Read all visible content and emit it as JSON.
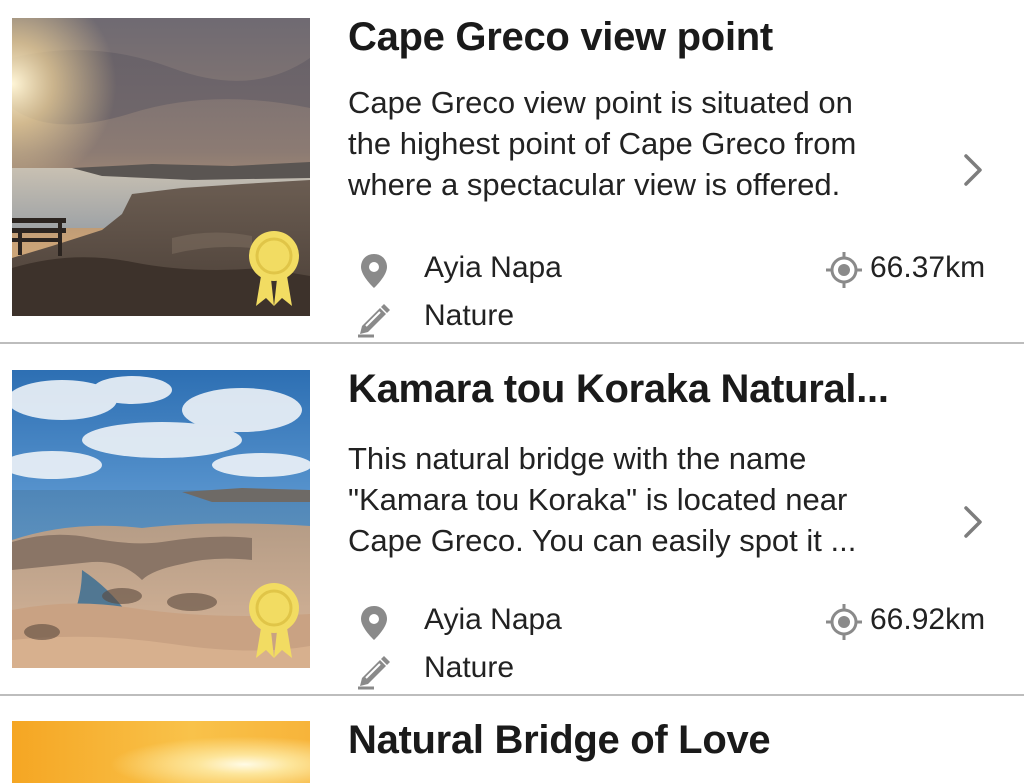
{
  "places": [
    {
      "title": "Cape Greco view point",
      "description_lines": [
        "Cape Greco view point is situated on",
        "the highest point of Cape Greco from",
        "where a spectacular view is offered."
      ],
      "location": "Ayia Napa",
      "category": "Nature",
      "distance": "66.37km",
      "badge_icon": "award-ribbon-icon"
    },
    {
      "title": "Kamara tou Koraka Natural...",
      "description_lines": [
        "This natural bridge with the name",
        "\"Kamara tou Koraka\" is located near",
        "Cape Greco. You can easily spot it ..."
      ],
      "location": "Ayia Napa",
      "category": "Nature",
      "distance": "66.92km",
      "badge_icon": "award-ribbon-icon"
    },
    {
      "title": "Natural Bridge of Love"
    }
  ],
  "icons": {
    "location": "map-pin-icon",
    "category": "pencil-tag-icon",
    "distance": "crosshair-target-icon",
    "chevron": "chevron-right-icon"
  },
  "colors": {
    "badge": "#f2dc62",
    "icon_gray": "#8a8a8a",
    "divider": "#bdbdbd"
  }
}
